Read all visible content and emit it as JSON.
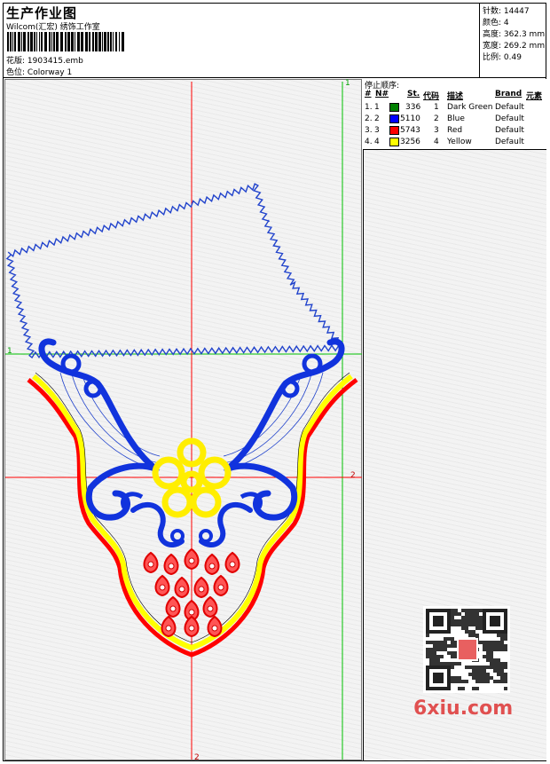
{
  "header": {
    "title": "生产作业图",
    "company": "Wilcom(汇宏) 绣饰工作室",
    "design_label": "花版:",
    "design_value": "1903415.emb",
    "colorway_label": "色位:",
    "colorway_value": "Colorway 1"
  },
  "stats": [
    {
      "label": "针数:",
      "value": "14447"
    },
    {
      "label": "颜色:",
      "value": "4"
    },
    {
      "label": "高度:",
      "value": "362.3 mm"
    },
    {
      "label": "宽度:",
      "value": "269.2 mm"
    },
    {
      "label": "比例:",
      "value": "0.49"
    }
  ],
  "stop_sequence": {
    "title": "停止顺序:",
    "columns": [
      "#",
      "N#",
      "St.",
      "代码",
      "描述",
      "Brand",
      "元素"
    ],
    "rows": [
      {
        "idx": "1.",
        "n": "1",
        "swatch": "#008000",
        "st": "336",
        "code": "1",
        "desc": "Dark Green",
        "brand": "Default"
      },
      {
        "idx": "2.",
        "n": "2",
        "swatch": "#0000ff",
        "st": "5110",
        "code": "2",
        "desc": "Blue",
        "brand": "Default"
      },
      {
        "idx": "3.",
        "n": "3",
        "swatch": "#ff0000",
        "st": "5743",
        "code": "3",
        "desc": "Red",
        "brand": "Default"
      },
      {
        "idx": "4.",
        "n": "4",
        "swatch": "#ffff00",
        "st": "3256",
        "code": "4",
        "desc": "Yellow",
        "brand": "Default"
      }
    ]
  },
  "guides": {
    "green_v_label": "1",
    "green_h_label": "1",
    "red_h_label": "2",
    "red_v_label": "2"
  },
  "colors": {
    "green_thread": "#008000",
    "blue_thread": "#0000ff",
    "red_thread": "#ff0000",
    "yellow_thread": "#ffff00",
    "guide_green": "#00c000",
    "guide_red": "#ff0000"
  },
  "watermark": {
    "text": "6xiu.com",
    "qr_label": "QR-code"
  }
}
